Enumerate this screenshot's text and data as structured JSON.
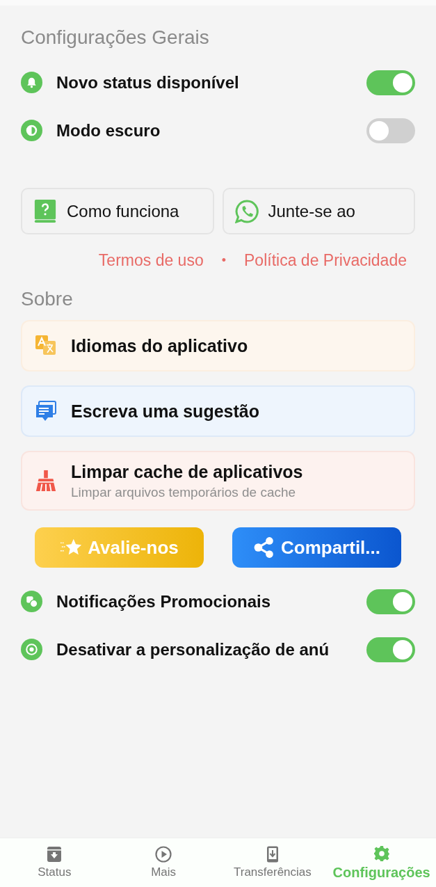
{
  "general": {
    "title": "Configurações Gerais",
    "toggles": [
      {
        "label": "Novo status disponível",
        "on": true
      },
      {
        "label": "Modo escuro",
        "on": false
      }
    ]
  },
  "actions": [
    {
      "label": "Como funciona"
    },
    {
      "label": "Junte-se ao"
    }
  ],
  "links": {
    "items": [
      "Termos de uso",
      "Política de Privacidade"
    ],
    "separator": "•"
  },
  "about": {
    "title": "Sobre",
    "cards": [
      {
        "title": "Idiomas do aplicativo"
      },
      {
        "title": "Escreva uma sugestão"
      },
      {
        "title": "Limpar cache de aplicativos",
        "subtitle": "Limpar arquivos temporários de cache"
      }
    ]
  },
  "share_buttons": [
    {
      "label": "Avalie-nos"
    },
    {
      "label": "Compartil..."
    }
  ],
  "more_toggles": [
    {
      "label": "Notificações Promocionais",
      "on": true
    },
    {
      "label": "Desativar a personalização de anú",
      "on": true
    }
  ],
  "nav": [
    {
      "label": "Status",
      "selected": false
    },
    {
      "label": "Mais",
      "selected": false
    },
    {
      "label": "Transferências",
      "selected": false
    },
    {
      "label": "Configurações",
      "selected": true
    }
  ]
}
